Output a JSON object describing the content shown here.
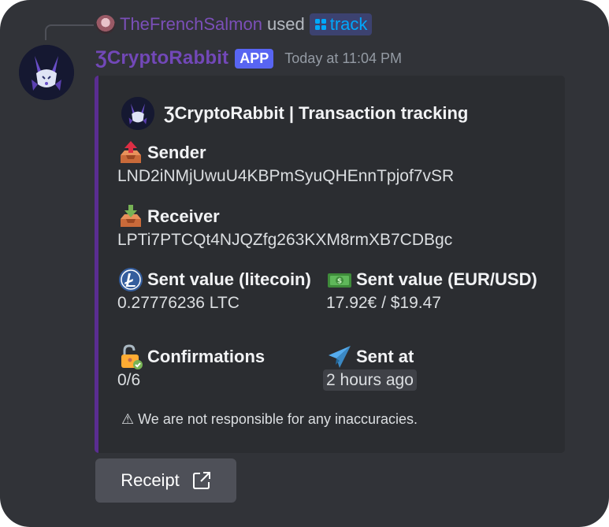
{
  "reply": {
    "username": "TheFrenchSalmon",
    "used_text": "used",
    "command": "track"
  },
  "message": {
    "bot_name": "ƷCryptoRabbit",
    "app_badge": "APP",
    "timestamp": "Today at 11:04 PM"
  },
  "embed": {
    "accent_color": "#5a2d91",
    "author": "ƷCryptoRabbit | Transaction tracking",
    "fields": {
      "sender": {
        "icon": "outbox-tray-icon",
        "name": "Sender",
        "value": "LND2iNMjUwuU4KBPmSyuQHEnnTpjof7vSR"
      },
      "receiver": {
        "icon": "inbox-tray-icon",
        "name": "Receiver",
        "value": "LPTi7PTCQt4NJQZfg263KXM8rmXB7CDBgc"
      },
      "sent_ltc": {
        "icon": "litecoin-icon",
        "name": "Sent value (litecoin)",
        "value": "0.27776236 LTC"
      },
      "sent_fiat": {
        "icon": "dollar-banknote-icon",
        "name": "Sent value (EUR/USD)",
        "value": "17.92€ / $19.47"
      },
      "confirmations": {
        "icon": "lock-check-icon",
        "name": "Confirmations",
        "value": "0/6"
      },
      "sent_at": {
        "icon": "paper-plane-icon",
        "name": "Sent at",
        "value": "2 hours ago"
      }
    },
    "footer": "⚠ We are not responsible for any inaccuracies."
  },
  "button": {
    "label": "Receipt",
    "icon": "external-link-icon"
  }
}
